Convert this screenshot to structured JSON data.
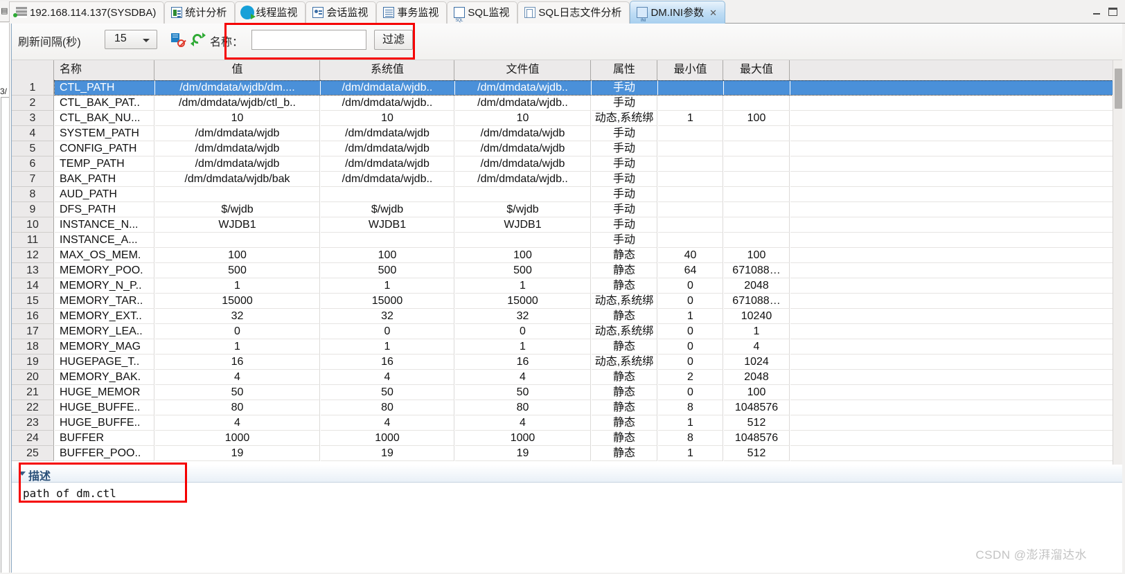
{
  "window": {
    "minimize_label": "—",
    "maximize_label": "□"
  },
  "tabs": [
    {
      "label": "192.168.114.137(SYSDBA)",
      "icon": "server-icon",
      "active": false,
      "closable": false
    },
    {
      "label": "统计分析",
      "icon": "chart-icon",
      "active": false,
      "closable": false
    },
    {
      "label": "线程监视",
      "icon": "gear-icon",
      "active": false,
      "closable": false
    },
    {
      "label": "会话监视",
      "icon": "session-icon",
      "active": false,
      "closable": false
    },
    {
      "label": "事务监视",
      "icon": "transaction-icon",
      "active": false,
      "closable": false
    },
    {
      "label": "SQL监视",
      "icon": "sql-icon",
      "active": false,
      "closable": false
    },
    {
      "label": "SQL日志文件分析",
      "icon": "log-file-icon",
      "active": false,
      "closable": false
    },
    {
      "label": "DM.INI参数",
      "icon": "ini-file-icon",
      "active": true,
      "closable": true,
      "close_glyph": "✕"
    }
  ],
  "toolbar": {
    "refresh_interval_label": "刷新间隔(秒)",
    "refresh_interval_value": "15",
    "pause_icon": "pause-refresh-icon",
    "refresh_icon": "refresh-icon",
    "name_label": "名称：",
    "name_value": "",
    "name_placeholder": "",
    "filter_button": "过滤"
  },
  "table": {
    "columns": [
      "名称",
      "值",
      "系统值",
      "文件值",
      "属性",
      "最小值",
      "最大值",
      ""
    ],
    "rows": [
      {
        "num": "1",
        "name": "CTL_PATH",
        "value": "/dm/dmdata/wjdb/dm....",
        "sysvalue": "/dm/dmdata/wjdb..",
        "filevalue": "/dm/dmdata/wjdb..",
        "attr": "手动",
        "min": "",
        "max": ""
      },
      {
        "num": "2",
        "name": "CTL_BAK_PAT..",
        "value": "/dm/dmdata/wjdb/ctl_b..",
        "sysvalue": "/dm/dmdata/wjdb..",
        "filevalue": "/dm/dmdata/wjdb..",
        "attr": "手动",
        "min": "",
        "max": ""
      },
      {
        "num": "3",
        "name": "CTL_BAK_NU...",
        "value": "10",
        "sysvalue": "10",
        "filevalue": "10",
        "attr": "动态,系统绑",
        "min": "1",
        "max": "100"
      },
      {
        "num": "4",
        "name": "SYSTEM_PATH",
        "value": "/dm/dmdata/wjdb",
        "sysvalue": "/dm/dmdata/wjdb",
        "filevalue": "/dm/dmdata/wjdb",
        "attr": "手动",
        "min": "",
        "max": ""
      },
      {
        "num": "5",
        "name": "CONFIG_PATH",
        "value": "/dm/dmdata/wjdb",
        "sysvalue": "/dm/dmdata/wjdb",
        "filevalue": "/dm/dmdata/wjdb",
        "attr": "手动",
        "min": "",
        "max": ""
      },
      {
        "num": "6",
        "name": "TEMP_PATH",
        "value": "/dm/dmdata/wjdb",
        "sysvalue": "/dm/dmdata/wjdb",
        "filevalue": "/dm/dmdata/wjdb",
        "attr": "手动",
        "min": "",
        "max": ""
      },
      {
        "num": "7",
        "name": "BAK_PATH",
        "value": "/dm/dmdata/wjdb/bak",
        "sysvalue": "/dm/dmdata/wjdb..",
        "filevalue": "/dm/dmdata/wjdb..",
        "attr": "手动",
        "min": "",
        "max": ""
      },
      {
        "num": "8",
        "name": "AUD_PATH",
        "value": "",
        "sysvalue": "",
        "filevalue": "",
        "attr": "手动",
        "min": "",
        "max": ""
      },
      {
        "num": "9",
        "name": "DFS_PATH",
        "value": "$/wjdb",
        "sysvalue": "$/wjdb",
        "filevalue": "$/wjdb",
        "attr": "手动",
        "min": "",
        "max": ""
      },
      {
        "num": "10",
        "name": "INSTANCE_N...",
        "value": "WJDB1",
        "sysvalue": "WJDB1",
        "filevalue": "WJDB1",
        "attr": "手动",
        "min": "",
        "max": ""
      },
      {
        "num": "11",
        "name": "INSTANCE_A...",
        "value": "",
        "sysvalue": "",
        "filevalue": "",
        "attr": "手动",
        "min": "",
        "max": ""
      },
      {
        "num": "12",
        "name": "MAX_OS_MEM.",
        "value": "100",
        "sysvalue": "100",
        "filevalue": "100",
        "attr": "静态",
        "min": "40",
        "max": "100"
      },
      {
        "num": "13",
        "name": "MEMORY_POO.",
        "value": "500",
        "sysvalue": "500",
        "filevalue": "500",
        "attr": "静态",
        "min": "64",
        "max": "671088…"
      },
      {
        "num": "14",
        "name": "MEMORY_N_P..",
        "value": "1",
        "sysvalue": "1",
        "filevalue": "1",
        "attr": "静态",
        "min": "0",
        "max": "2048"
      },
      {
        "num": "15",
        "name": "MEMORY_TAR..",
        "value": "15000",
        "sysvalue": "15000",
        "filevalue": "15000",
        "attr": "动态,系统绑",
        "min": "0",
        "max": "671088…"
      },
      {
        "num": "16",
        "name": "MEMORY_EXT..",
        "value": "32",
        "sysvalue": "32",
        "filevalue": "32",
        "attr": "静态",
        "min": "1",
        "max": "10240"
      },
      {
        "num": "17",
        "name": "MEMORY_LEA..",
        "value": "0",
        "sysvalue": "0",
        "filevalue": "0",
        "attr": "动态,系统绑",
        "min": "0",
        "max": "1"
      },
      {
        "num": "18",
        "name": "MEMORY_MAG",
        "value": "1",
        "sysvalue": "1",
        "filevalue": "1",
        "attr": "静态",
        "min": "0",
        "max": "4"
      },
      {
        "num": "19",
        "name": "HUGEPAGE_T..",
        "value": "16",
        "sysvalue": "16",
        "filevalue": "16",
        "attr": "动态,系统绑",
        "min": "0",
        "max": "1024"
      },
      {
        "num": "20",
        "name": "MEMORY_BAK.",
        "value": "4",
        "sysvalue": "4",
        "filevalue": "4",
        "attr": "静态",
        "min": "2",
        "max": "2048"
      },
      {
        "num": "21",
        "name": "HUGE_MEMOR",
        "value": "50",
        "sysvalue": "50",
        "filevalue": "50",
        "attr": "静态",
        "min": "0",
        "max": "100"
      },
      {
        "num": "22",
        "name": "HUGE_BUFFE..",
        "value": "80",
        "sysvalue": "80",
        "filevalue": "80",
        "attr": "静态",
        "min": "8",
        "max": "1048576"
      },
      {
        "num": "23",
        "name": "HUGE_BUFFE..",
        "value": "4",
        "sysvalue": "4",
        "filevalue": "4",
        "attr": "静态",
        "min": "1",
        "max": "512"
      },
      {
        "num": "24",
        "name": "BUFFER",
        "value": "1000",
        "sysvalue": "1000",
        "filevalue": "1000",
        "attr": "静态",
        "min": "8",
        "max": "1048576"
      },
      {
        "num": "25",
        "name": "BUFFER_POO..",
        "value": "19",
        "sysvalue": "19",
        "filevalue": "19",
        "attr": "静态",
        "min": "1",
        "max": "512"
      }
    ],
    "selected_row_index": 0
  },
  "description": {
    "section_title": "描述",
    "text": "path of dm.ctl"
  },
  "watermark": "CSDN @澎湃溜达水",
  "colors": {
    "selection": "#4a90d9",
    "highlight_box": "#f50000",
    "header_bg": "#eceaea",
    "active_tab": "#bedcf4"
  }
}
